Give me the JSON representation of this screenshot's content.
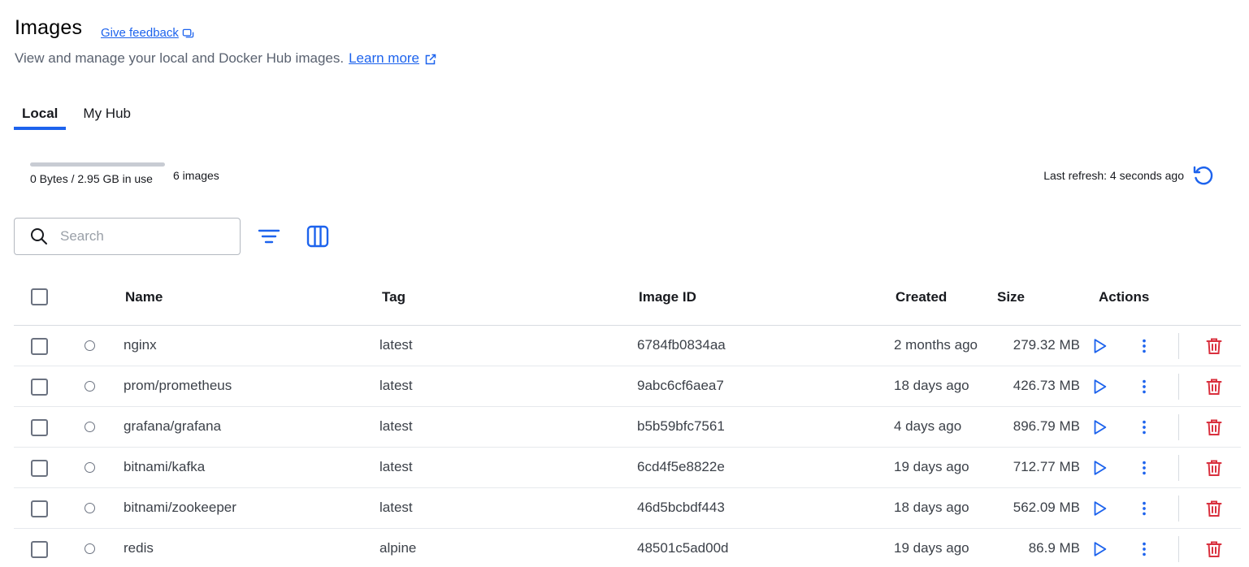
{
  "header": {
    "title": "Images",
    "feedback_label": "Give feedback",
    "subtitle": "View and manage your local and Docker Hub images.",
    "learn_more_label": "Learn more"
  },
  "tabs": [
    {
      "label": "Local",
      "active": true
    },
    {
      "label": "My Hub",
      "active": false
    }
  ],
  "summary": {
    "disk_usage": "0 Bytes / 2.95 GB in use",
    "disk_usage_fraction": 0,
    "image_count": "6 images",
    "last_refresh": "Last refresh: 4 seconds ago"
  },
  "search": {
    "placeholder": "Search",
    "value": ""
  },
  "table": {
    "columns": {
      "name": "Name",
      "tag": "Tag",
      "image_id": "Image ID",
      "created": "Created",
      "size": "Size",
      "actions": "Actions"
    },
    "rows": [
      {
        "name": "nginx",
        "tag": "latest",
        "image_id": "6784fb0834aa",
        "created": "2 months ago",
        "size": "279.32 MB"
      },
      {
        "name": "prom/prometheus",
        "tag": "latest",
        "image_id": "9abc6cf6aea7",
        "created": "18 days ago",
        "size": "426.73 MB"
      },
      {
        "name": "grafana/grafana",
        "tag": "latest",
        "image_id": "b5b59bfc7561",
        "created": "4 days ago",
        "size": "896.79 MB"
      },
      {
        "name": "bitnami/kafka",
        "tag": "latest",
        "image_id": "6cd4f5e8822e",
        "created": "19 days ago",
        "size": "712.77 MB"
      },
      {
        "name": "bitnami/zookeeper",
        "tag": "latest",
        "image_id": "46d5bcbdf443",
        "created": "18 days ago",
        "size": "562.09 MB"
      },
      {
        "name": "redis",
        "tag": "alpine",
        "image_id": "48501c5ad00d",
        "created": "19 days ago",
        "size": "86.9 MB"
      }
    ]
  },
  "colors": {
    "accent": "#1d63ed",
    "danger": "#d9303e",
    "text": "#17191e",
    "muted": "#5a6270"
  },
  "icons": {
    "feedback": "feedback-icon",
    "external_link": "external-link-icon",
    "refresh": "refresh-icon",
    "search": "search-icon",
    "filter": "filter-icon",
    "columns": "columns-icon",
    "run": "play-icon",
    "more": "more-vertical-icon",
    "delete": "trash-icon"
  }
}
